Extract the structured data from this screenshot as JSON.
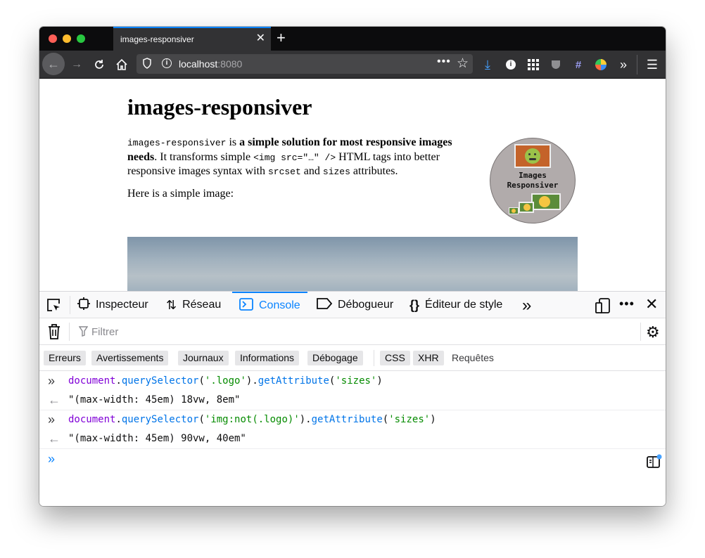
{
  "browser": {
    "tab_title": "images-responsiver",
    "url_host": "localhost",
    "url_port": ":8080"
  },
  "page": {
    "heading": "images-responsiver",
    "intro_code": "images-responsiver",
    "intro_is": " is ",
    "intro_bold": "a simple solution for most responsive images needs",
    "intro_rest1": ". It transforms simple ",
    "intro_tag": "<img src=\"…\" />",
    "intro_rest2": " HTML tags into better responsive images syntax with ",
    "intro_srcset": "srcset",
    "intro_and": " and ",
    "intro_sizes": "sizes",
    "intro_end": " attributes.",
    "simple_image_text": "Here is a simple image:",
    "logo_line1": "Images",
    "logo_line2": "Responsiver"
  },
  "devtools": {
    "tabs": [
      "Inspecteur",
      "Réseau",
      "Console",
      "Débogueur",
      "Éditeur de style"
    ],
    "selected_tab": "Console",
    "filter_placeholder": "Filtrer",
    "categories": [
      "Erreurs",
      "Avertissements",
      "Journaux",
      "Informations",
      "Débogage",
      "CSS",
      "XHR",
      "Requêtes"
    ],
    "console": [
      {
        "input_obj": "document",
        "input_dot": ".",
        "input_fn": "querySelector",
        "input_open": "(",
        "input_arg": "'.logo'",
        "input_close": ").",
        "input_fn2": "getAttribute",
        "input_open2": "(",
        "input_arg2": "'sizes'",
        "input_close2": ")",
        "output": "\"(max-width: 45em) 18vw, 8em\""
      },
      {
        "input_obj": "document",
        "input_dot": ".",
        "input_fn": "querySelector",
        "input_open": "(",
        "input_arg": "'img:not(.logo)'",
        "input_close": ").",
        "input_fn2": "getAttribute",
        "input_open2": "(",
        "input_arg2": "'sizes'",
        "input_close2": ")",
        "output": "\"(max-width: 45em) 90vw, 40em\""
      }
    ]
  },
  "colors": {
    "accent": "#0a84ff",
    "keyword": "#8000d7",
    "function": "#0074e8",
    "string": "#058b00"
  }
}
